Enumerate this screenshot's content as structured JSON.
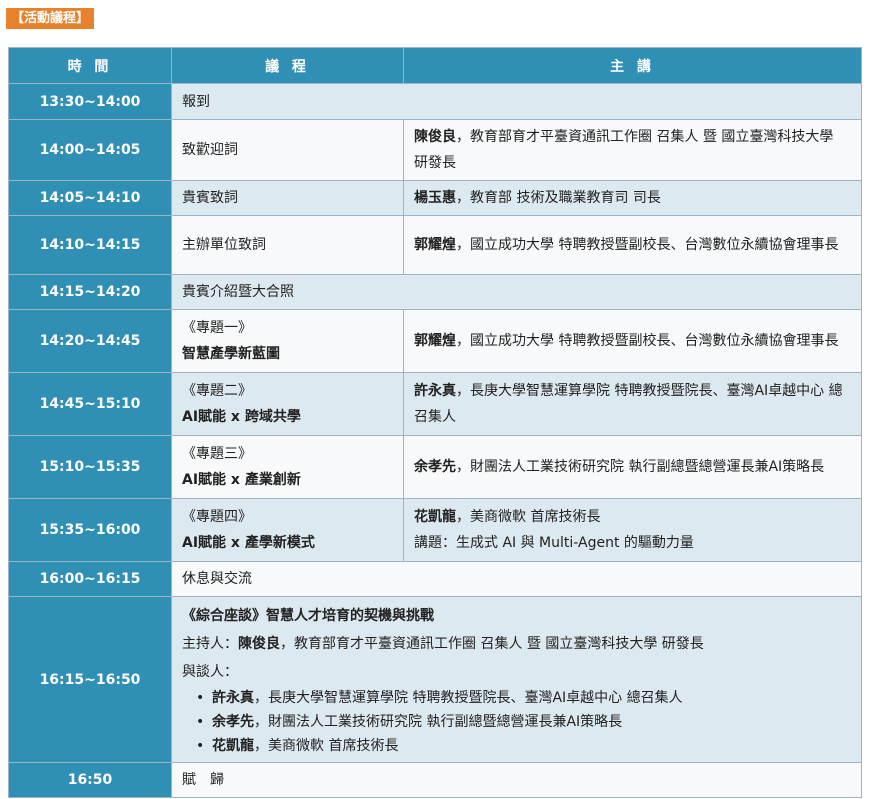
{
  "section_label": "【活動議程】",
  "headers": {
    "time": "時 間",
    "agenda": "議 程",
    "speaker": "主 講"
  },
  "rows": [
    {
      "time": "13:30~14:00",
      "topic": "報到"
    },
    {
      "time": "14:00~14:05",
      "topic": "致歡迎詞",
      "speaker_name": "陳俊良",
      "speaker_title": "，教育部育才平臺資通訊工作圈 召集人 暨 國立臺灣科技大學 研發長"
    },
    {
      "time": "14:05~14:10",
      "topic": "貴賓致詞",
      "speaker_name": "楊玉惠",
      "speaker_title": "，教育部 技術及職業教育司 司長"
    },
    {
      "time": "14:10~14:15",
      "topic": "主辦單位致詞",
      "speaker_name": "郭耀煌",
      "speaker_title": "，國立成功大學 特聘教授暨副校長、台灣數位永續協會理事長"
    },
    {
      "time": "14:15~14:20",
      "topic": "貴賓介紹暨大合照"
    },
    {
      "time": "14:20~14:45",
      "topic_line1": "《專題一》",
      "topic_line2": "智慧產學新藍圖",
      "speaker_name": "郭耀煌",
      "speaker_title": "，國立成功大學 特聘教授暨副校長、台灣數位永續協會理事長"
    },
    {
      "time": "14:45~15:10",
      "topic_line1": "《專題二》",
      "topic_line2": "AI賦能 x 跨域共學",
      "speaker_name": "許永真",
      "speaker_title": "，長庚大學智慧運算學院 特聘教授暨院長、臺灣AI卓越中心 總召集人"
    },
    {
      "time": "15:10~15:35",
      "topic_line1": "《專題三》",
      "topic_line2": "AI賦能 x 產業創新",
      "speaker_name": "余孝先",
      "speaker_title": "，財團法人工業技術研究院 執行副總暨總營運長兼AI策略長"
    },
    {
      "time": "15:35~16:00",
      "topic_line1": "《專題四》",
      "topic_line2": "AI賦能 x 產學新模式",
      "speaker_name": "花凱龍",
      "speaker_title": "，美商微軟 首席技術長",
      "speaker_extra": "講題：生成式 AI 與 Multi-Agent 的驅動力量"
    },
    {
      "time": "16:00~16:15",
      "topic": "休息與交流"
    },
    {
      "time": "16:15~16:50",
      "panel_title": "《綜合座談》智慧人才培育的契機與挑戰",
      "host_label": "主持人：",
      "host_name": "陳俊良",
      "host_title": "，教育部育才平臺資通訊工作圈 召集人 暨 國立臺灣科技大學 研發長",
      "panelists_label": "與談人：",
      "panelists": [
        {
          "name": "許永真",
          "title": "，長庚大學智慧運算學院 特聘教授暨院長、臺灣AI卓越中心 總召集人"
        },
        {
          "name": "余孝先",
          "title": "，財團法人工業技術研究院 執行副總暨總營運長兼AI策略長"
        },
        {
          "name": "花凱龍",
          "title": "，美商微軟 首席技術長"
        }
      ]
    },
    {
      "time": "16:50",
      "topic": "賦　歸"
    }
  ]
}
